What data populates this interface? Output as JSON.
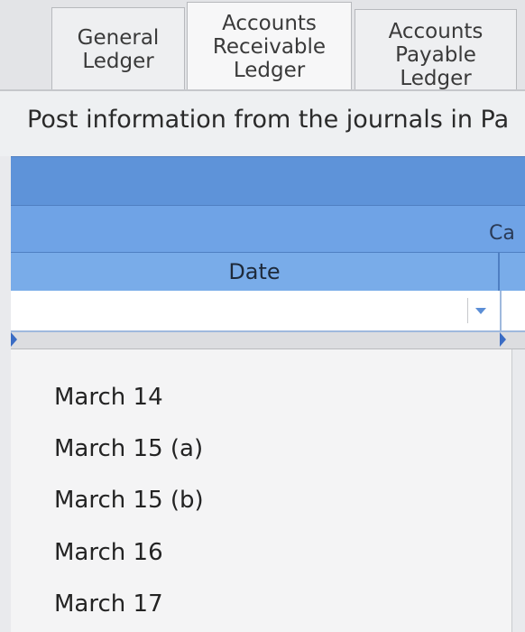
{
  "tabs": [
    {
      "lines": [
        "General",
        "Ledger"
      ]
    },
    {
      "lines": [
        "Accounts",
        "Receivable",
        "Ledger"
      ]
    },
    {
      "lines": [
        "Accounts",
        "Payable",
        "Ledger"
      ]
    }
  ],
  "instruction": "Post information from the journals in Pa",
  "table": {
    "date_header": "Date",
    "cash_header": "Ca"
  },
  "dropdown": {
    "options": [
      "March 14",
      "March 15 (a)",
      "March 15 (b)",
      "March 16",
      "March 17"
    ]
  }
}
